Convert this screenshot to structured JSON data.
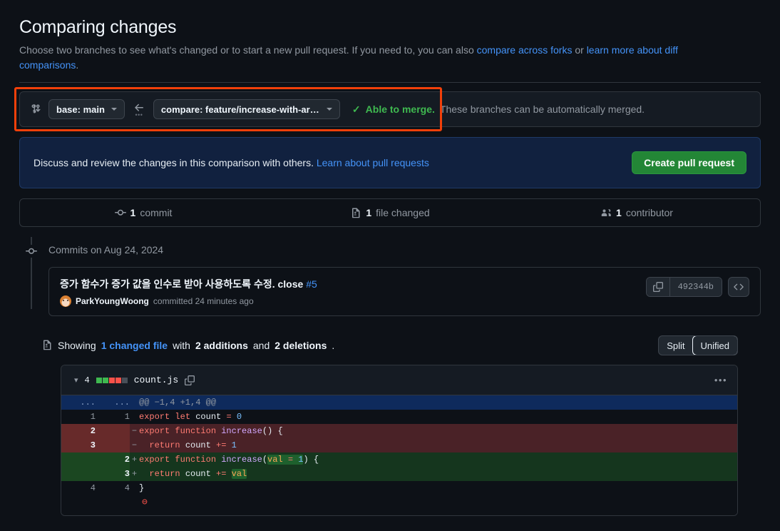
{
  "page": {
    "title": "Comparing changes",
    "lede_pre": "Choose two branches to see what's changed or to start a new pull request. If you need to, you can also ",
    "lede_link1": "compare across forks",
    "lede_mid": " or ",
    "lede_link2": "learn more about diff comparisons",
    "lede_end": "."
  },
  "compare_bar": {
    "compare_icon": "git-compare-icon",
    "base_label": "base: main",
    "arrow_icon": "arrow-left-icon",
    "compare_label": "compare: feature/increase-with-argum…",
    "check_icon": "check-icon",
    "status_title": "Able to merge.",
    "status_desc": "These branches can be automatically merged."
  },
  "pr_banner": {
    "text": "Discuss and review the changes in this comparison with others.",
    "link": "Learn about pull requests",
    "button": "Create pull request"
  },
  "stats": [
    {
      "icon": "commit-icon",
      "count": "1",
      "label": "commit"
    },
    {
      "icon": "file-diff-icon",
      "count": "1",
      "label": "file changed"
    },
    {
      "icon": "people-icon",
      "count": "1",
      "label": "contributor"
    }
  ],
  "commits": {
    "date_heading": "Commits on Aug 24, 2024",
    "message": "증가 함수가 증가 값을 인수로 받아 사용하도록 수정. close",
    "issue_ref": "#5",
    "author": "ParkYoungWoong",
    "committed_text": "committed 24 minutes ago",
    "sha": "492344b",
    "copy_icon": "copy-icon",
    "code_icon": "code-icon"
  },
  "showing": {
    "icon": "file-diff-icon",
    "pre": "Showing",
    "file_link": "1 changed file",
    "mid": "with",
    "additions": "2 additions",
    "and": "and",
    "deletions": "2 deletions",
    "end": ".",
    "view_split": "Split",
    "view_unified": "Unified",
    "view_selected": "Unified"
  },
  "diff": {
    "chevron_icon": "chevron-down-icon",
    "change_count": "4",
    "stat_blocks": [
      "add",
      "add",
      "del",
      "del",
      "none"
    ],
    "filename": "count.js",
    "copy_icon": "copy-icon",
    "kebab_icon": "kebab-horizontal-icon",
    "colors": {
      "add_block": "#3fb950",
      "del_block": "#f85149",
      "none_block": "#484f58"
    },
    "rows": [
      {
        "type": "hunk",
        "old": "...",
        "new": "...",
        "mark": "",
        "code_html": "@@ −1,4 +1,4 @@"
      },
      {
        "type": "ctx",
        "old": "1",
        "new": "1",
        "mark": "",
        "code_html": "<span class='k'>export</span> <span class='k'>let</span> count <span class='k'>=</span> <span class='n'>0</span>"
      },
      {
        "type": "del",
        "old": "2",
        "new": "",
        "mark": "−",
        "code_html": "<span class='k'>export</span> <span class='k'>function</span> <span class='fn'>increase</span>() {"
      },
      {
        "type": "del",
        "old": "3",
        "new": "",
        "mark": "−",
        "code_html": "  <span class='k'>return</span> count <span class='k'>+=</span> <span class='n'>1</span>"
      },
      {
        "type": "add",
        "old": "",
        "new": "2",
        "mark": "+",
        "code_html": "<span class='k'>export</span> <span class='k'>function</span> <span class='fn'>increase</span>(<span class='hl-add'><span class='v'>val</span> <span class='k'>=</span> <span class='n'>1</span></span>) {"
      },
      {
        "type": "add",
        "old": "",
        "new": "3",
        "mark": "+",
        "code_html": "  <span class='k'>return</span> count <span class='k'>+=</span> <span class='hl-add'><span class='v'>val</span></span>"
      },
      {
        "type": "ctx",
        "old": "4",
        "new": "4",
        "mark": "",
        "code_html": "}"
      },
      {
        "type": "last",
        "old": "",
        "new": "",
        "mark": "",
        "code_html": "<span class='nodot'>⊖</span>"
      }
    ]
  },
  "annotation": {
    "type": "red-highlight-box",
    "color": "#f2400a"
  }
}
